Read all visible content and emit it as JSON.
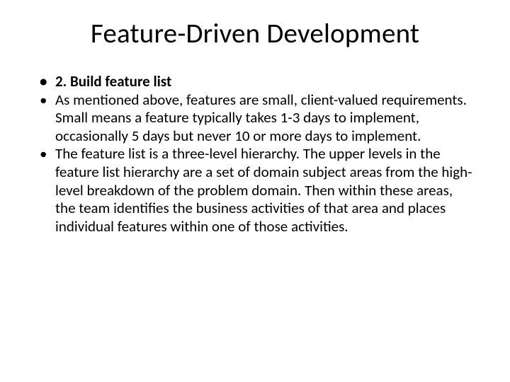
{
  "slide": {
    "title": "Feature-Driven Development",
    "bullets": [
      {
        "text": "2. Build feature list",
        "bold": true
      },
      {
        "text": "As mentioned above, features are small, client-valued requirements. Small means a feature typically takes 1-3 days to implement, occasionally 5 days but never 10 or more days to implement.",
        "bold": false
      },
      {
        "text": "The feature list is a three-level hierarchy. The upper levels in the feature list hierarchy are a set of domain subject areas from the high-level breakdown of the problem domain. Then within these areas, the team identifies the business activities of that area and places individual features within one of those activities.",
        "bold": false
      }
    ]
  }
}
